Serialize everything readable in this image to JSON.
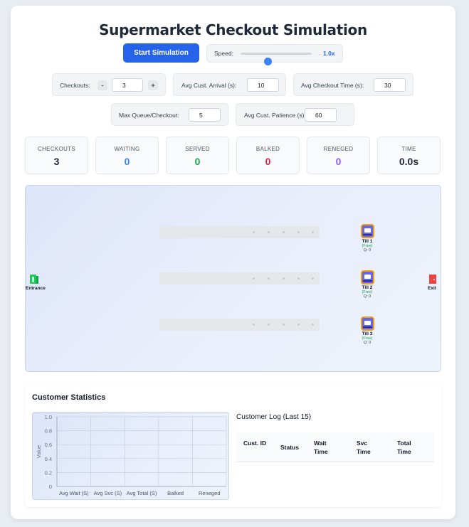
{
  "title": "Supermarket Checkout Simulation",
  "controls": {
    "start_label": "Start Simulation",
    "speed_label": "Speed:",
    "speed_value": "1.0x",
    "speed_level": 0.38,
    "checkouts_label": "Checkouts:",
    "checkouts_value": "3",
    "minus": "-",
    "plus": "+",
    "arrival_label": "Avg Cust. Arrival (s):",
    "arrival_value": "10",
    "checkout_time_label": "Avg Checkout Time (s):",
    "checkout_time_value": "30",
    "max_queue_label": "Max Queue/Checkout:",
    "max_queue_value": "5",
    "patience_label": "Avg Cust. Patience (s):",
    "patience_value": "60"
  },
  "stats": [
    {
      "label": "CHECKOUTS",
      "value": "3",
      "color": "#1f2937"
    },
    {
      "label": "WAITING",
      "value": "0",
      "color": "#3b82f6"
    },
    {
      "label": "SERVED",
      "value": "0",
      "color": "#16a34a"
    },
    {
      "label": "BALKED",
      "value": "0",
      "color": "#e11d48"
    },
    {
      "label": "RENEGED",
      "value": "0",
      "color": "#8b5cf6"
    },
    {
      "label": "TIME",
      "value": "0.0s",
      "color": "#1f2937"
    }
  ],
  "sim": {
    "entrance_label": "Entrance",
    "exit_label": "Exit",
    "tills": [
      {
        "name": "Till 1",
        "status": "(Free)",
        "queue": "Q: 0"
      },
      {
        "name": "Till 2",
        "status": "(Free)",
        "queue": "Q: 0"
      },
      {
        "name": "Till 3",
        "status": "(Free)",
        "queue": "Q: 0"
      }
    ]
  },
  "bottom": {
    "section_title": "Customer Statistics",
    "log_title": "Customer Log (Last 15)",
    "log_columns": [
      "Cust. ID",
      "Status",
      "Wait Time",
      "Svc Time",
      "Total Time"
    ]
  },
  "colors": {
    "accent": "#2563eb",
    "till": "#6366f1",
    "till_border": "#f59e0b",
    "entrance": "#22c55e",
    "exit": "#ef4444"
  },
  "chart_data": {
    "type": "bar",
    "categories": [
      "Avg Wait (S)",
      "Avg Svc (S)",
      "Avg Total (S)",
      "Balked",
      "Reneged"
    ],
    "values": [
      0,
      0,
      0,
      0,
      0
    ],
    "ylabel": "Value",
    "ylim": [
      0,
      1.0
    ],
    "yticks": [
      "0",
      "0.2",
      "0.4",
      "0.6",
      "0.8",
      "1.0"
    ],
    "grid": true
  }
}
